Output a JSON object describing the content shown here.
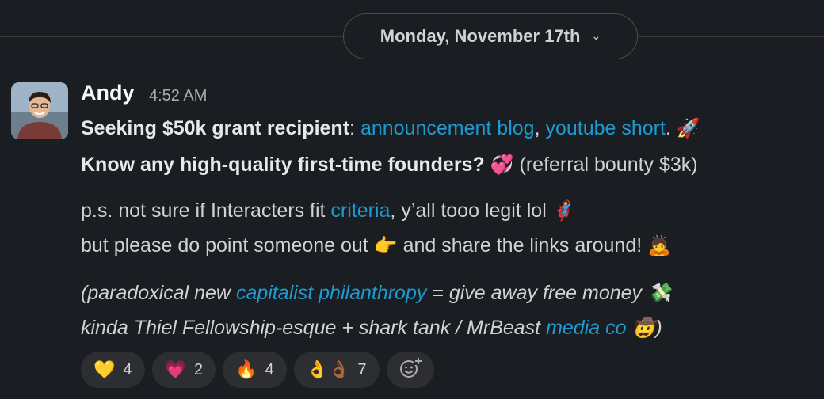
{
  "date_divider": {
    "label": "Monday, November 17th",
    "icon": "chevron-down-icon"
  },
  "message": {
    "author": "Andy",
    "time": "4:52 AM",
    "line1": {
      "bold": "Seeking $50k grant recipient",
      "sep": ": ",
      "link1": "announcement blog",
      "comma": ", ",
      "link2": "youtube short",
      "end": ".",
      "emoji": "🚀"
    },
    "line2": {
      "bold": "Know any high-quality first-time founders?",
      "emoji": "💞",
      "rest": "(referral bounty $3k)"
    },
    "line3": {
      "text": "p.s. not sure if Interacters fit ",
      "link": "criteria",
      "rest": ", y’all tooo legit lol",
      "emoji": "🦸"
    },
    "line4": {
      "text": "but please do point someone out",
      "emoji": "👉",
      "rest": "and share the links around!",
      "emoji2": "🙇"
    },
    "line5": {
      "text": "(paradoxical new ",
      "link": "capitalist philanthropy",
      "rest": " = give away free money",
      "emoji": "💸"
    },
    "line6": {
      "text": "kinda Thiel Fellowship-esque + shark tank / MrBeast ",
      "link": "media co",
      "emoji": "🤠",
      "end": ")"
    }
  },
  "reactions": [
    {
      "emoji": "💛",
      "count": "4"
    },
    {
      "emoji": "💗",
      "count": "2"
    },
    {
      "emoji": "🔥",
      "count": "4"
    },
    {
      "emoji": "👌👌🏾",
      "count": "7"
    }
  ],
  "add_reaction_icon": "add-reaction-icon"
}
